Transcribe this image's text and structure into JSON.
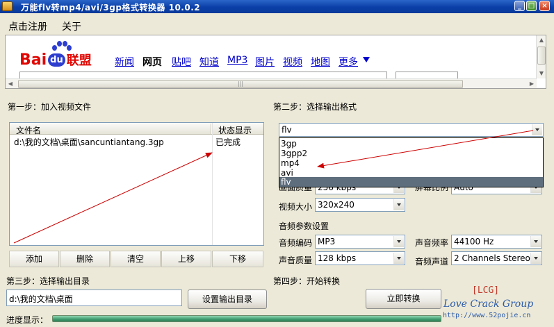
{
  "window": {
    "title": "万能flv转mp4/avi/3gp格式转换器 10.0.2"
  },
  "menu": {
    "register": "点击注册",
    "about": "关于"
  },
  "browser": {
    "logo_bai": "Bai",
    "logo_du": "du",
    "logo_lianmeng": "联盟",
    "nav": [
      {
        "label": "新闻",
        "active": false
      },
      {
        "label": "网页",
        "active": true
      },
      {
        "label": "贴吧",
        "active": false
      },
      {
        "label": "知道",
        "active": false
      },
      {
        "label": "MP3",
        "active": false
      },
      {
        "label": "图片",
        "active": false
      },
      {
        "label": "视频",
        "active": false
      },
      {
        "label": "地图",
        "active": false
      },
      {
        "label": "更多",
        "active": false
      }
    ]
  },
  "step1": {
    "label": "第一步：加入视频文件",
    "columns": {
      "filename": "文件名",
      "status": "状态显示"
    },
    "rows": [
      {
        "filename": "d:\\我的文档\\桌面\\sancuntiantang.3gp",
        "status": "已完成"
      }
    ],
    "buttons": {
      "add": "添加",
      "delete": "删除",
      "clear": "清空",
      "up": "上移",
      "down": "下移"
    }
  },
  "step2": {
    "label": "第二步：选择输出格式",
    "format": {
      "value": "flv",
      "options": [
        "3gp",
        "3gpp2",
        "mp4",
        "avi",
        "flv"
      ],
      "selected": "flv"
    },
    "video_quality": {
      "label": "画面质量",
      "value": "256 kbps"
    },
    "aspect_ratio": {
      "label": "屏幕比例",
      "value": "Auto"
    },
    "video_size": {
      "label": "视频大小",
      "value": "320x240"
    },
    "audio_settings_label": "音频参数设置",
    "audio_codec": {
      "label": "音频编码",
      "value": "MP3"
    },
    "sample_rate": {
      "label": "声音频率",
      "value": "44100 Hz"
    },
    "audio_quality": {
      "label": "声音质量",
      "value": "128 kbps"
    },
    "channels": {
      "label": "音频声道",
      "value": "2 Channels Stereo"
    }
  },
  "step3": {
    "label": "第三步：选择输出目录",
    "path": "d:\\我的文档\\桌面",
    "set_dir_button": "设置输出目录"
  },
  "step4": {
    "label": "第四步：开始转换",
    "convert_button": "立即转换"
  },
  "watermark": {
    "tag": "[LCG]",
    "text": "Love Crack Group",
    "url": "http://www.52pojie.cn"
  },
  "progress": {
    "label": "进度显示：",
    "value": 1.0
  },
  "colors": {
    "annotation_arrow": "#cc0000",
    "titlebar": "#0b3fa8",
    "progress": "#3f9b6f"
  }
}
